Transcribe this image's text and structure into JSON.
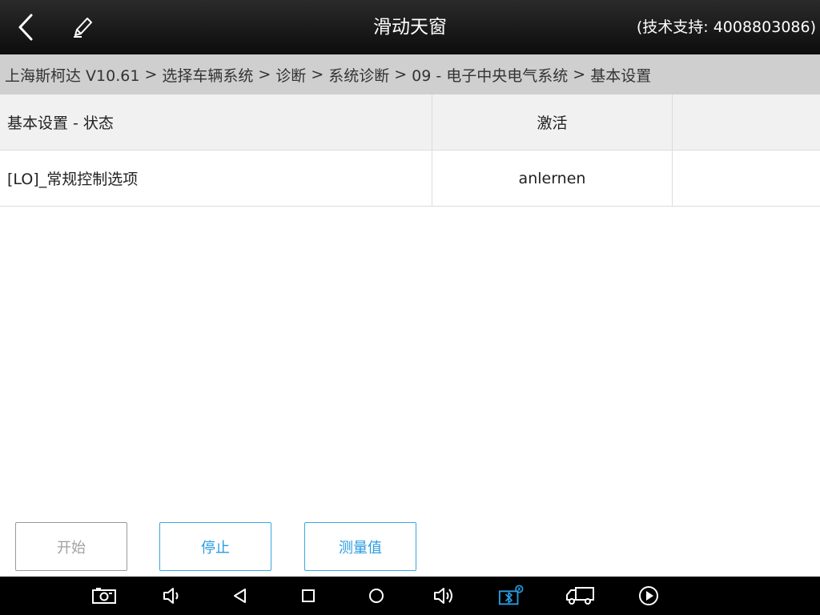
{
  "topbar": {
    "title": "滑动天窗",
    "support": "(技术支持: 4008803086)",
    "back_icon": "chevron-left-icon",
    "edit_icon": "pencil-icon"
  },
  "breadcrumb": {
    "items": [
      "上海斯柯达 V10.61",
      "选择车辆系统",
      "诊断",
      "系统诊断",
      "09 - 电子中央电气系统",
      "基本设置"
    ],
    "separator": ">"
  },
  "table": {
    "headers": [
      "基本设置 - 状态",
      "激活",
      ""
    ],
    "rows": [
      [
        "[LO]_常规控制选项",
        "anlernen",
        ""
      ]
    ]
  },
  "actions": {
    "start": "开始",
    "stop": "停止",
    "measure": "测量值"
  },
  "navbar": {
    "icons": [
      "screenshot-icon",
      "volume-down-icon",
      "back-triangle-icon",
      "recents-square-icon",
      "home-circle-icon",
      "volume-up-icon",
      "bluetooth-vci-icon",
      "truck-icon",
      "play-circle-icon"
    ]
  },
  "colors": {
    "toolbar": "#1a1a1a",
    "breadcrumb_bg": "#cfcfcf",
    "header_row_bg": "#f1f1f1",
    "accent": "#2a9be0",
    "disabled": "#a0a0a0"
  }
}
